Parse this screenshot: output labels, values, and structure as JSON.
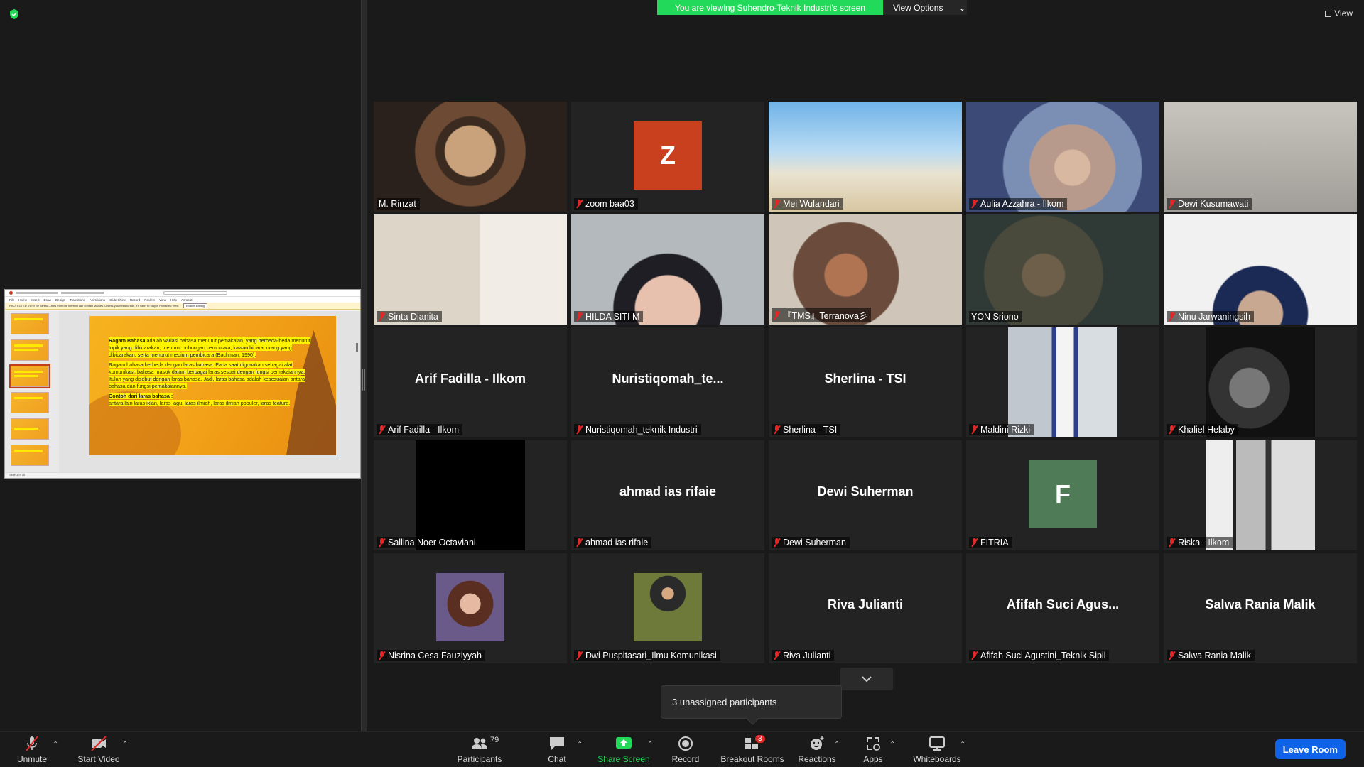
{
  "banner": {
    "text": "You are viewing Suhendro-Teknik Industri's screen",
    "view_options": "View Options"
  },
  "view_button": "View",
  "shared_slide": {
    "menu": [
      "File",
      "Home",
      "Insert",
      "Draw",
      "Design",
      "Transitions",
      "Animations",
      "Slide Show",
      "Record",
      "Review",
      "View",
      "Help",
      "Acrobat"
    ],
    "protected_view": "PROTECTED VIEW   Be careful—files from the Internet can contain viruses. Unless you need to edit, it's safer to stay in Protected View.",
    "enable_editing": "Enable Editing",
    "slide_count": "Slide 3 of 16",
    "p1_title": "Ragam Bahasa",
    "p1_text": " adalah variasi bahasa menurut pemakaian, yang berbeda-beda menurut topik yang dibicarakan, menurut hubungan pembicara, kawan bicara, orang yang dibicarakan, serta menurut medium pembicara (Bachman, 1990).",
    "p2_text": "Ragam bahasa berbeda dengan laras bahasa. Pada saat digunakan sebagai alat komunikasi, bahasa masuk dalam berbagai laras sesuai dengan fungsi pemakaiannya. Itulah yang disebut dengan laras bahasa. Jadi, laras bahasa adalah kesesuaian antara bahasa dan fungsi pemakaiannya.",
    "p3_title": "Contoh dari laras bahasa :",
    "p3_text": "antara lain laras iklan, laras lagu, laras ilmiah, laras ilmiah populer, laras feature."
  },
  "participants_tiles": [
    {
      "name": "M. Rinzat",
      "kind": "video",
      "muted": false,
      "active": true
    },
    {
      "name": "zoom baa03",
      "kind": "avatar",
      "initial": "Z",
      "color": "#c8401e",
      "muted": true
    },
    {
      "name": "Mei Wulandari",
      "kind": "video",
      "muted": true
    },
    {
      "name": "Aulia Azzahra - Ilkom",
      "kind": "video",
      "muted": true
    },
    {
      "name": "Dewi Kusumawati",
      "kind": "video",
      "muted": true
    },
    {
      "name": "Sinta Dianita",
      "kind": "video",
      "muted": true
    },
    {
      "name": "HILDA SITI M",
      "kind": "video",
      "muted": true
    },
    {
      "name": "『TMS』Terranova彡",
      "kind": "video",
      "muted": true
    },
    {
      "name": "YON Sriono",
      "kind": "video",
      "muted": false
    },
    {
      "name": "Ninu Jarwaningsih",
      "kind": "video",
      "muted": true
    },
    {
      "name": "Arif Fadilla - Ilkom",
      "kind": "text",
      "display": "Arif Fadilla - Ilkom",
      "muted": true
    },
    {
      "name": "Nuristiqomah_teknik Industri",
      "kind": "text",
      "display": "Nuristiqomah_te...",
      "muted": true
    },
    {
      "name": "Sherlina - TSI",
      "kind": "text",
      "display": "Sherlina - TSI",
      "muted": true
    },
    {
      "name": "Maldini Rizki",
      "kind": "photo",
      "muted": true
    },
    {
      "name": "Khaliel Helaby",
      "kind": "photo",
      "muted": true
    },
    {
      "name": "Sallina Noer Octaviani",
      "kind": "photo",
      "muted": true
    },
    {
      "name": "ahmad ias rifaie",
      "kind": "text",
      "display": "ahmad ias rifaie",
      "muted": true
    },
    {
      "name": "Dewi Suherman",
      "kind": "text",
      "display": "Dewi Suherman",
      "muted": true
    },
    {
      "name": "FITRIA",
      "kind": "avatar",
      "initial": "F",
      "color": "#4f7b56",
      "muted": true
    },
    {
      "name": "Riska - Ilkom",
      "kind": "photo",
      "muted": true
    },
    {
      "name": "Nisrina Cesa Fauziyyah",
      "kind": "photo",
      "muted": true
    },
    {
      "name": "Dwi Puspitasari_Ilmu Komunikasi",
      "kind": "photo",
      "muted": true
    },
    {
      "name": "Riva Julianti",
      "kind": "text",
      "display": "Riva Julianti",
      "muted": true
    },
    {
      "name": "Afifah Suci Agustini_Teknik Sipil",
      "kind": "text",
      "display": "Afifah Suci Agus...",
      "muted": true
    },
    {
      "name": "Salwa Rania Malik",
      "kind": "text",
      "display": "Salwa Rania Malik",
      "muted": true
    }
  ],
  "toast": "3 unassigned participants",
  "toolbar": {
    "unmute": "Unmute",
    "start_video": "Start Video",
    "participants": "Participants",
    "participants_count": "79",
    "chat": "Chat",
    "share_screen": "Share Screen",
    "record": "Record",
    "breakout_rooms": "Breakout Rooms",
    "breakout_badge": "3",
    "reactions": "Reactions",
    "apps": "Apps",
    "whiteboards": "Whiteboards",
    "leave": "Leave Room"
  },
  "colors": {
    "accent_green": "#23d959",
    "leave_blue": "#0e63e8",
    "active_speaker": "#d4f04a",
    "mute_red": "#e02828"
  }
}
